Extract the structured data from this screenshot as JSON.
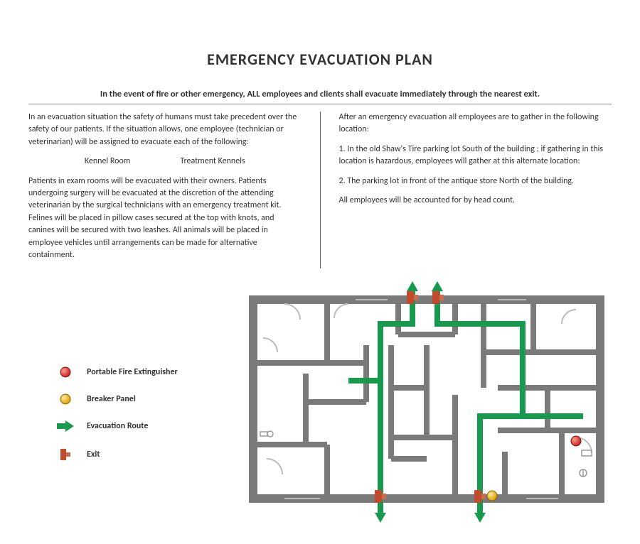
{
  "title": "EMERGENCY EVACUATION PLAN",
  "subhead": "In the event of fire or other emergency, ALL employees and clients shall evacuate immediately through the nearest exit.",
  "left": {
    "p1": "In an evacuation situation the safety of humans must take precedent over the safety of our patients. If the situation allows, one employee (technician or veterinarian) will be assigned to evacuate each of the following:",
    "kennel1": "Kennel Room",
    "kennel2": "Treatment Kennels",
    "p2": "Patients in exam rooms will be evacuated with their owners. Patients undergoing surgery will be evacuated at the discretion of the attending veterinarian by the surgical technicians with an emergency treatment kit. Felines will be placed in pillow cases secured at the top with knots, and canines will be secured with two leashes. All animals will be placed in employee vehicles until arrangements can be made for alternative containment."
  },
  "right": {
    "p1": "After an emergency evacuation all employees are to gather in the following location:",
    "item1": "1.   In the old Shaw's Tire parking lot South of the building ; if gathering in this location is hazardous, employees will gather at this alternate location:",
    "item2": "2.  The parking lot in front of the antique store North of the building.",
    "p2": "All employees will be accounted for by head count."
  },
  "legend": {
    "extinguisher": "Portable Fire Extinguisher",
    "breaker": "Breaker Panel",
    "route": "Evacuation Route",
    "exit": "Exit"
  },
  "colors": {
    "wall": "#7a7a7a",
    "route": "#179a4d",
    "extinguisher": "#e03a2e",
    "breaker": "#f2b70f",
    "exit": "#c34a2c"
  }
}
